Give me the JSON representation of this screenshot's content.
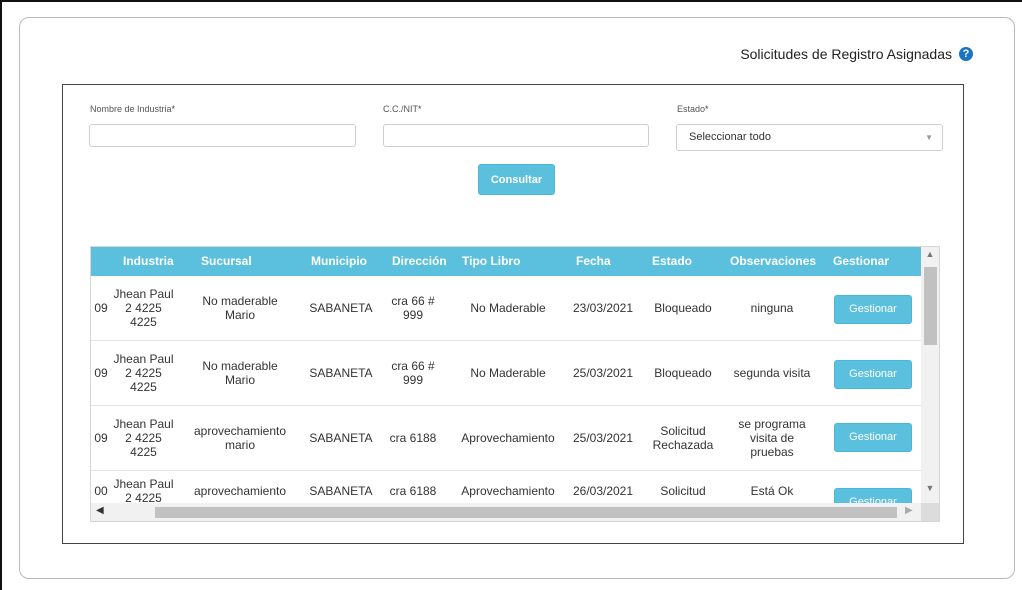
{
  "header": {
    "title": "Solicitudes de Registro Asignadas",
    "help_icon": "?"
  },
  "form": {
    "industria_label": "Nombre de Industria",
    "nit_label": "C.C./NIT",
    "estado_label": "Estado",
    "required_mark": "*",
    "industria_value": "",
    "nit_value": "",
    "estado_selected": "Seleccionar todo",
    "consultar_label": "Consultar"
  },
  "table": {
    "headers": [
      "Industria",
      "Sucursal",
      "Municipio",
      "Dirección",
      "Tipo Libro",
      "Fecha",
      "Estado",
      "Observaciones",
      "Gestionar"
    ],
    "rows": [
      {
        "id": "09",
        "industria": "Jhean Paul\n2 4225\n4225",
        "sucursal": "No maderable\nMario",
        "municipio": "SABANETA",
        "direccion": "cra 66 #\n999",
        "tipo": "No Maderable",
        "fecha": "23/03/2021",
        "estado": "Bloqueado",
        "obs": "ninguna",
        "gestionar": "Gestionar"
      },
      {
        "id": "09",
        "industria": "Jhean Paul\n2 4225\n4225",
        "sucursal": "No maderable\nMario",
        "municipio": "SABANETA",
        "direccion": "cra 66 #\n999",
        "tipo": "No Maderable",
        "fecha": "25/03/2021",
        "estado": "Bloqueado",
        "obs": "segunda visita",
        "gestionar": "Gestionar"
      },
      {
        "id": "09",
        "industria": "Jhean Paul\n2 4225\n4225",
        "sucursal": "aprovechamiento\nmario",
        "municipio": "SABANETA",
        "direccion": "cra 6188",
        "tipo": "Aprovechamiento",
        "fecha": "25/03/2021",
        "estado": "Solicitud\nRechazada",
        "obs": "se programa\nvisita de\npruebas",
        "gestionar": "Gestionar"
      },
      {
        "id": "00",
        "industria": "Jhean Paul\n2 4225",
        "sucursal": "aprovechamiento",
        "municipio": "SABANETA",
        "direccion": "cra 6188",
        "tipo": "Aprovechamiento",
        "fecha": "26/03/2021",
        "estado": "Solicitud",
        "obs": "Está Ok",
        "gestionar": "Gestionar"
      }
    ]
  }
}
